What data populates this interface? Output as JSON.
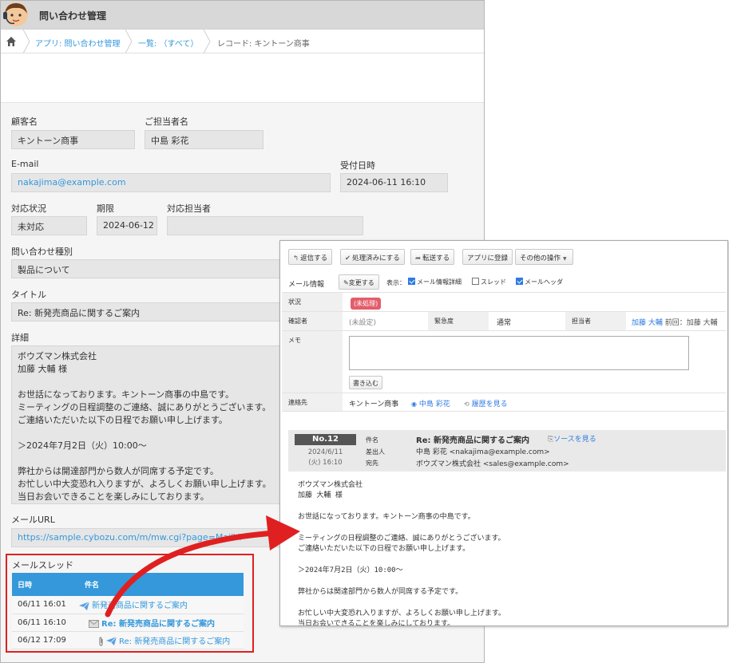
{
  "app": {
    "title": "問い合わせ管理"
  },
  "breadcrumb": {
    "app": "アプリ: 問い合わせ管理",
    "view": "一覧: （すべて）",
    "record": "レコード: キントーン商事"
  },
  "record": {
    "customer_label": "顧客名",
    "customer": "キントーン商事",
    "contact_label": "ご担当者名",
    "contact": "中島 彩花",
    "email_label": "E-mail",
    "email": "nakajima@example.com",
    "received_label": "受付日時",
    "received": "2024-06-11 16:10",
    "status_label": "対応状況",
    "status": "未対応",
    "deadline_label": "期限",
    "deadline": "2024-06-12",
    "assignee_label": "対応担当者",
    "assignee": "",
    "category_label": "問い合わせ種別",
    "category": "製品について",
    "title_label": "タイトル",
    "title": "Re: 新発売商品に関するご案内",
    "detail_label": "詳細",
    "detail": "ボウズマン株式会社\n加藤 大輔 様\n\nお世話になっております。キントーン商事の中島です。\nミーティングの日程調整のご連絡、誠にありがとうございます。\nご連絡いただいた以下の日程でお願い申し上げます。\n\n＞2024年7月2日（火）10:00〜\n\n弊社からは開達部門から数人が同席する予定です。\nお忙しい中大変恐れ入りますが、よろしくお願い申し上げます。\n当日お会いできることを楽しみにしております。",
    "url_label": "メールURL",
    "url": "https://sample.cybozu.com/m/mw.cgi?page=MailVi",
    "thread_label": "メールスレッド",
    "thread_headers": [
      "日時",
      "件名"
    ],
    "thread_rows": [
      {
        "date": "06/11 16:01",
        "subject": "新発売商品に関するご案内"
      },
      {
        "date": "06/11 16:10",
        "subject": "Re: 新発売商品に関するご案内"
      },
      {
        "date": "06/12 17:09",
        "subject": "Re: 新発売商品に関するご案内"
      }
    ]
  },
  "mail": {
    "toolbar": {
      "reply": "返信する",
      "done": "処理済みにする",
      "forward": "転送する",
      "register": "アプリに登録",
      "other": "その他の操作"
    },
    "info_label": "メール情報",
    "change_btn": "変更する",
    "show_label": "表示：",
    "opt_detail": "メール情報詳細",
    "opt_thread": "スレッド",
    "opt_header": "メールヘッダ",
    "status_key": "状況",
    "status_badge": "(未処理)",
    "confirm_key": "確認者",
    "confirm_val": "(未設定)",
    "urgency_key": "緊急度",
    "urgency_val": "通常",
    "owner_key": "担当者",
    "owner_val": "加藤 大輔",
    "owner_prev": "前回：加藤 大輔",
    "memo_key": "メモ",
    "write_btn": "書き込む",
    "contact_key": "連絡先",
    "contact_company": "キントーン商事",
    "contact_person": "中島 彩花",
    "history": "履歴を見る",
    "no": "No.12",
    "date1": "2024/6/11",
    "date2": "(火) 16:10",
    "subject_key": "件名",
    "subject": "Re: 新発売商品に関するご案内",
    "source": "ソースを見る",
    "from_key": "差出人",
    "from": "中島 彩花 <nakajima@example.com>",
    "to_key": "宛先",
    "to": "ボウズマン株式会社 <sales@example.com>",
    "body": "ボウズマン株式会社\n加藤 大輔 様\n\nお世話になっております。キントーン商事の中島です。\n\nミーティングの日程調整のご連絡、誠にありがとうございます。\nご連絡いただいた以下の日程でお願い申し上げます。\n\n＞2024年7月2日（火）10:00〜\n\n弊社からは関達部門から数人が同席する予定です。\n\nお忙しい中大変恐れ入りますが、よろしくお願い申し上げます。\n当日お会いできることを楽しみにしております。"
  },
  "colors": {
    "accent": "#3498db",
    "highlight": "#e02020",
    "badge": "#e35d6a"
  }
}
